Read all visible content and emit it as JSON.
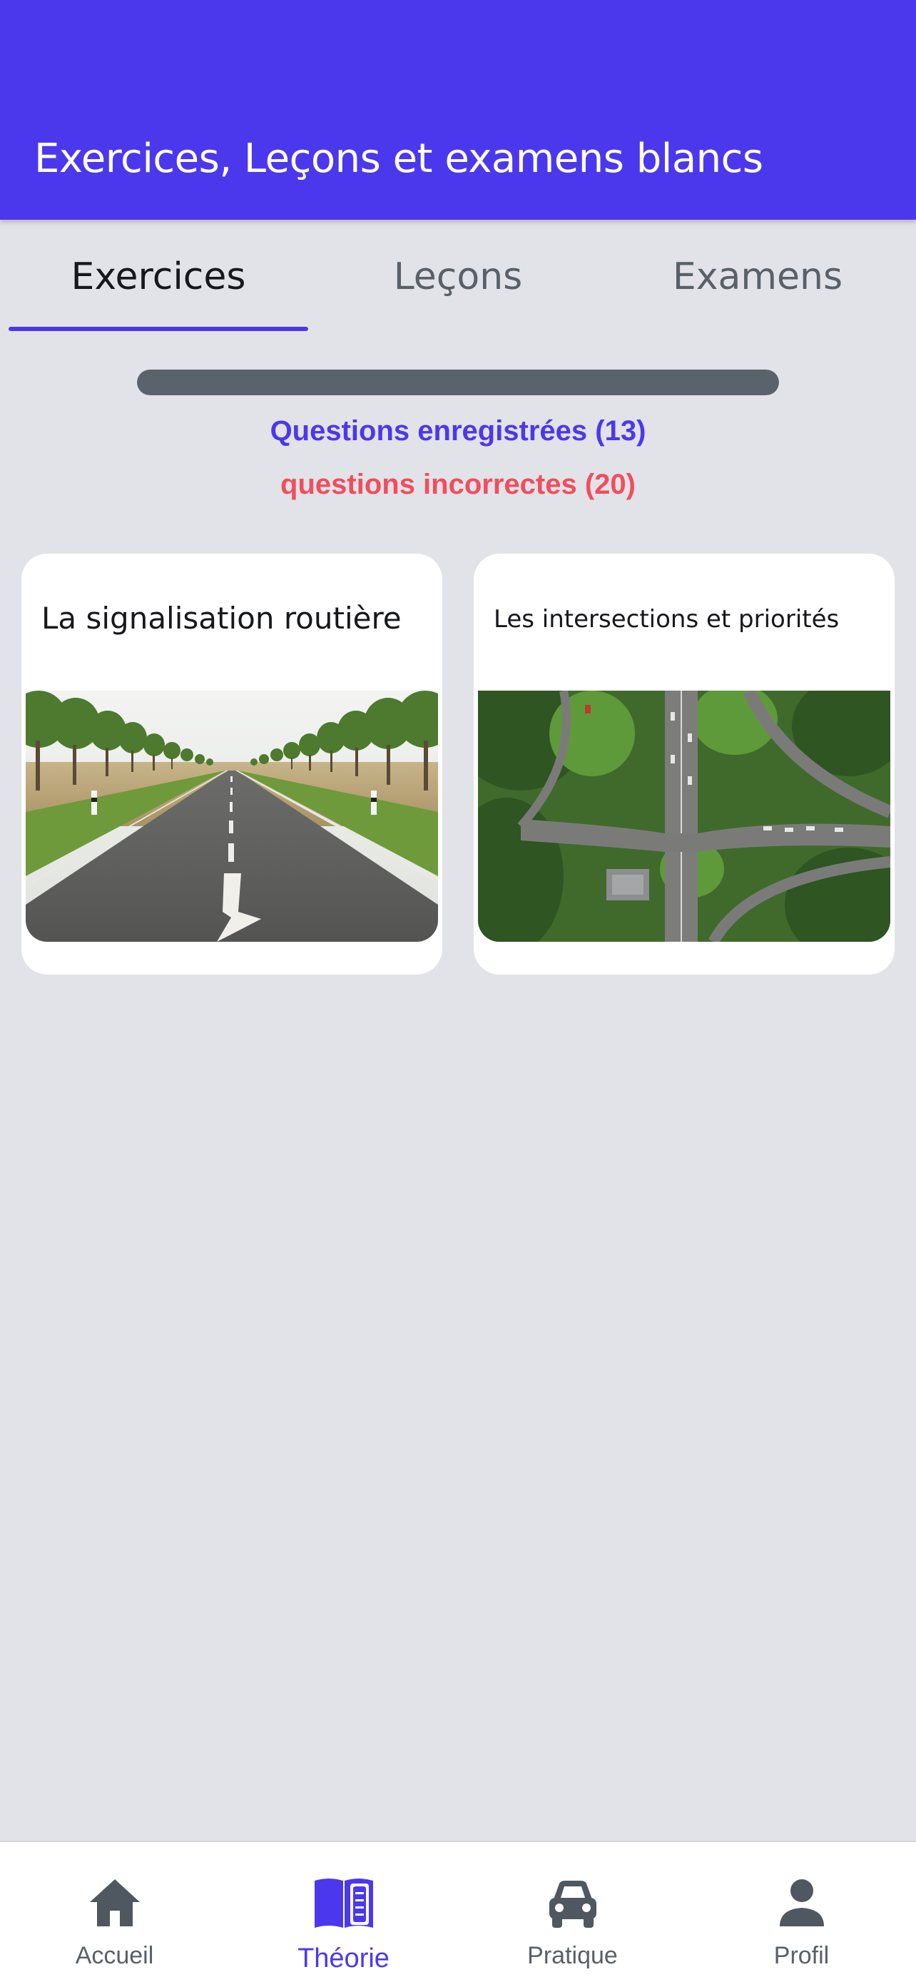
{
  "header": {
    "title": "Exercices, Leçons et examens blancs"
  },
  "tabs": [
    {
      "label": "Exercices",
      "active": true
    },
    {
      "label": "Leçons",
      "active": false
    },
    {
      "label": "Examens",
      "active": false
    }
  ],
  "progress": {
    "value": 1.0
  },
  "stats": {
    "saved_questions": "Questions enregistrées (13)",
    "incorrect_questions": "questions incorrectes (20)"
  },
  "cards": [
    {
      "title": "La signalisation routière",
      "image": "road-photo"
    },
    {
      "title": "Les intersections et priorités",
      "image": "intersection-aerial-photo"
    }
  ],
  "bottom_nav": [
    {
      "label": "Accueil",
      "icon": "home-icon",
      "active": false
    },
    {
      "label": "Théorie",
      "icon": "book-icon",
      "active": true
    },
    {
      "label": "Pratique",
      "icon": "car-icon",
      "active": false
    },
    {
      "label": "Profil",
      "icon": "person-icon",
      "active": false
    }
  ],
  "colors": {
    "primary": "#4c38ec",
    "error": "#f04e5e",
    "background": "#e1e3e8",
    "inactive": "#596069"
  }
}
